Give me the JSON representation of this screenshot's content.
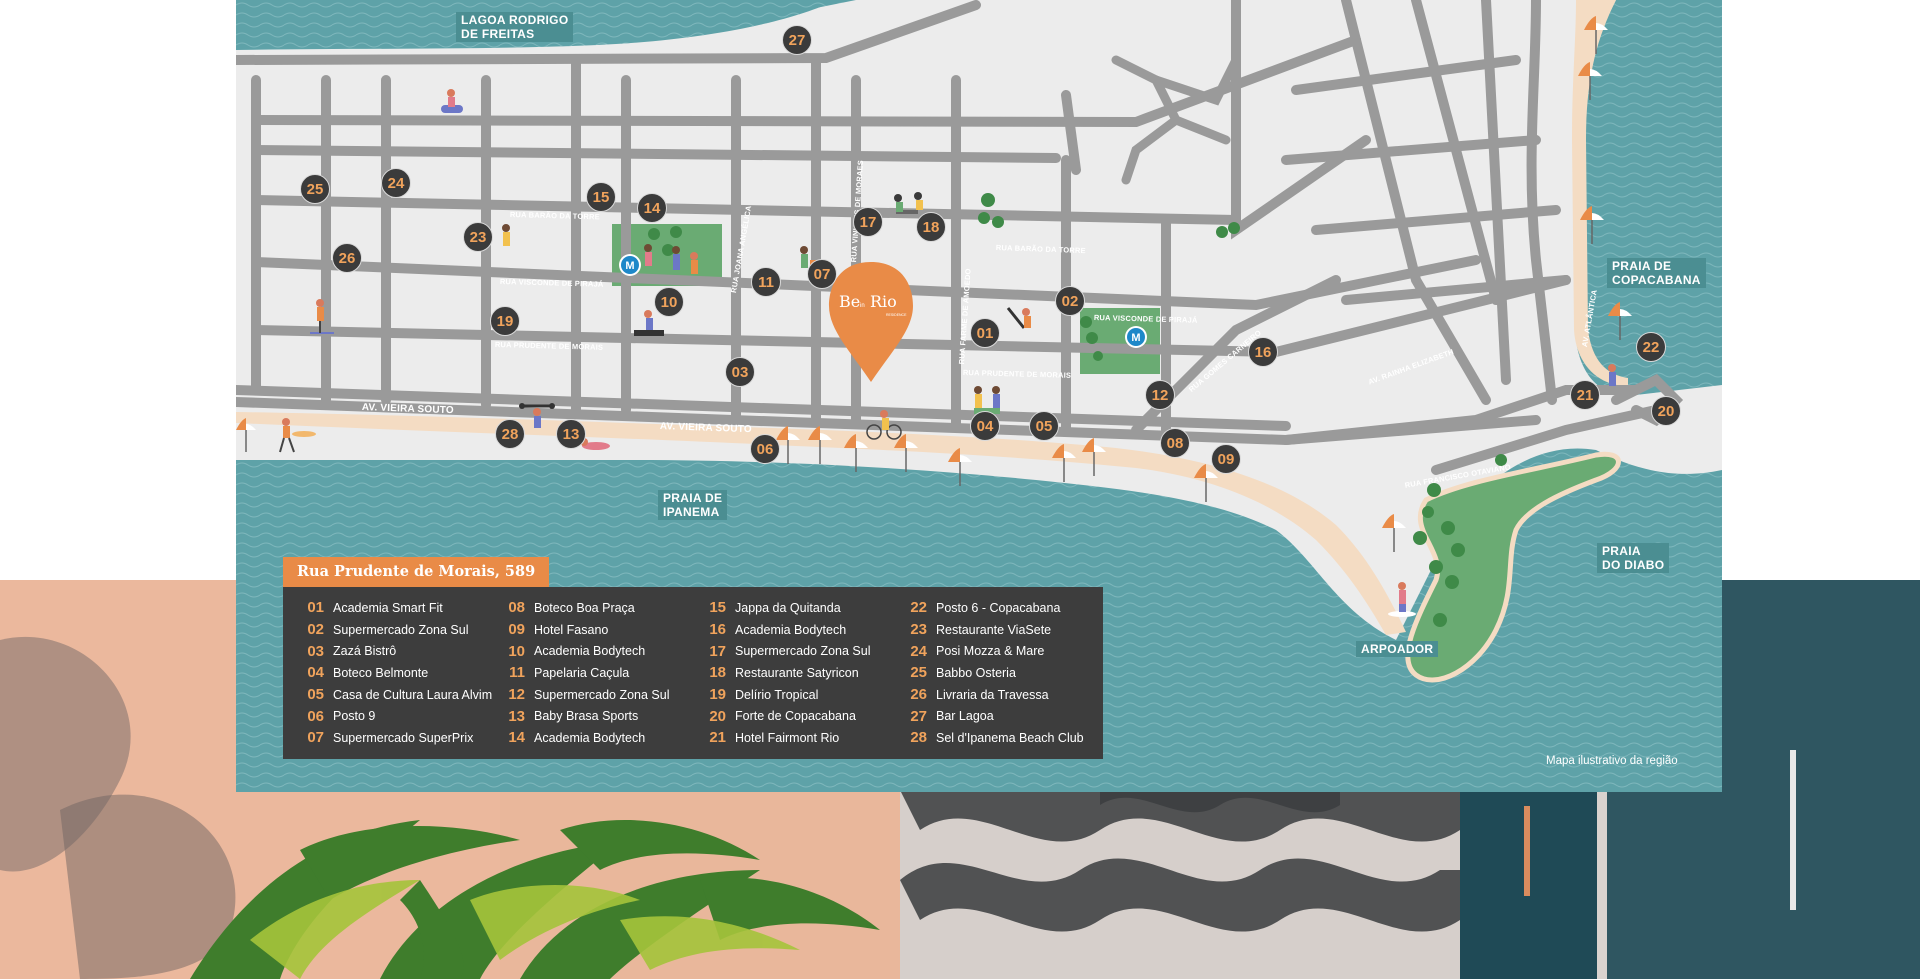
{
  "map": {
    "colors": {
      "water": "#5ea2a8",
      "land": "#ececec",
      "road": "#9a9a9a",
      "sand": "#f4dcc3",
      "park": "#6aab73",
      "poi_bg": "#3b3b3b",
      "poi_fg": "#f0a35c",
      "legend_bg": "#3d3d3d",
      "accent": "#e98b47"
    },
    "water_labels": {
      "lagoa": "LAGOA RODRIGO\nDE FREITAS",
      "ipanema": "PRAIA DE\nIPANEMA",
      "copacabana": "PRAIA DE\nCOPACABANA",
      "diabo": "PRAIA\nDO DIABO",
      "arpoador": "ARPOADOR"
    },
    "streets": {
      "barao_torre_left": "RUA BARÃO DA TORRE",
      "barao_torre_right": "RUA BARÃO DA TORRE",
      "visconde_left": "RUA VISCONDE DE PIRAJÁ",
      "visconde_right": "RUA VISCONDE DE PIRAJÁ",
      "prudente_left": "RUA PRUDENTE DE MORAIS",
      "prudente_right": "RUA PRUDENTE DE MORAIS",
      "vieira_souto_1": "AV. VIEIRA SOUTO",
      "vieira_souto_2": "AV. VIEIRA SOUTO",
      "joana_angelica": "RUA JOANA ANGÉLICA",
      "vinicius": "RUA VINICIUS DE MORAES",
      "farme": "RUA FARME DE AMOEDO",
      "gomes_carneiro": "RUA GOMES CARNEIRO",
      "rainha": "AV. RAINHA ELIZABETH",
      "francisco": "RUA FRANCISCO OTAVIANO",
      "atlantica": "AV. ATLÂNTICA"
    },
    "pin": {
      "line1": "Be",
      "small": "in",
      "line2": "Rio",
      "sub": "RESIDENCE"
    },
    "metro_label": "M",
    "markers": [
      "01",
      "02",
      "03",
      "04",
      "05",
      "06",
      "07",
      "08",
      "09",
      "10",
      "11",
      "12",
      "13",
      "14",
      "15",
      "16",
      "17",
      "18",
      "19",
      "20",
      "21",
      "22",
      "23",
      "24",
      "25",
      "26",
      "27",
      "28"
    ],
    "note": "Mapa ilustrativo da região"
  },
  "legend": {
    "title": "Rua Prudente de Morais, 589",
    "columns": [
      [
        {
          "num": "01",
          "name": "Academia Smart Fit"
        },
        {
          "num": "02",
          "name": "Supermercado Zona Sul"
        },
        {
          "num": "03",
          "name": "Zazá Bistrô"
        },
        {
          "num": "04",
          "name": "Boteco Belmonte"
        },
        {
          "num": "05",
          "name": "Casa de Cultura Laura Alvim"
        },
        {
          "num": "06",
          "name": "Posto 9"
        },
        {
          "num": "07",
          "name": "Supermercado SuperPrix"
        }
      ],
      [
        {
          "num": "08",
          "name": "Boteco Boa Praça"
        },
        {
          "num": "09",
          "name": "Hotel Fasano"
        },
        {
          "num": "10",
          "name": "Academia Bodytech"
        },
        {
          "num": "11",
          "name": "Papelaria Caçula"
        },
        {
          "num": "12",
          "name": "Supermercado Zona Sul"
        },
        {
          "num": "13",
          "name": "Baby Brasa Sports"
        },
        {
          "num": "14",
          "name": "Academia Bodytech"
        }
      ],
      [
        {
          "num": "15",
          "name": "Jappa da Quitanda"
        },
        {
          "num": "16",
          "name": "Academia Bodytech"
        },
        {
          "num": "17",
          "name": "Supermercado Zona Sul"
        },
        {
          "num": "18",
          "name": "Restaurante Satyricon"
        },
        {
          "num": "19",
          "name": "Delírio Tropical"
        },
        {
          "num": "20",
          "name": "Forte de Copacabana"
        },
        {
          "num": "21",
          "name": "Hotel Fairmont Rio"
        }
      ],
      [
        {
          "num": "22",
          "name": "Posto 6 - Copacabana"
        },
        {
          "num": "23",
          "name": "Restaurante ViaSete"
        },
        {
          "num": "24",
          "name": "Posi Mozza & Mare"
        },
        {
          "num": "25",
          "name": "Babbo Osteria"
        },
        {
          "num": "26",
          "name": "Livraria da Travessa"
        },
        {
          "num": "27",
          "name": "Bar Lagoa"
        },
        {
          "num": "28",
          "name": "Sel d'Ipanema Beach Club"
        }
      ]
    ]
  }
}
